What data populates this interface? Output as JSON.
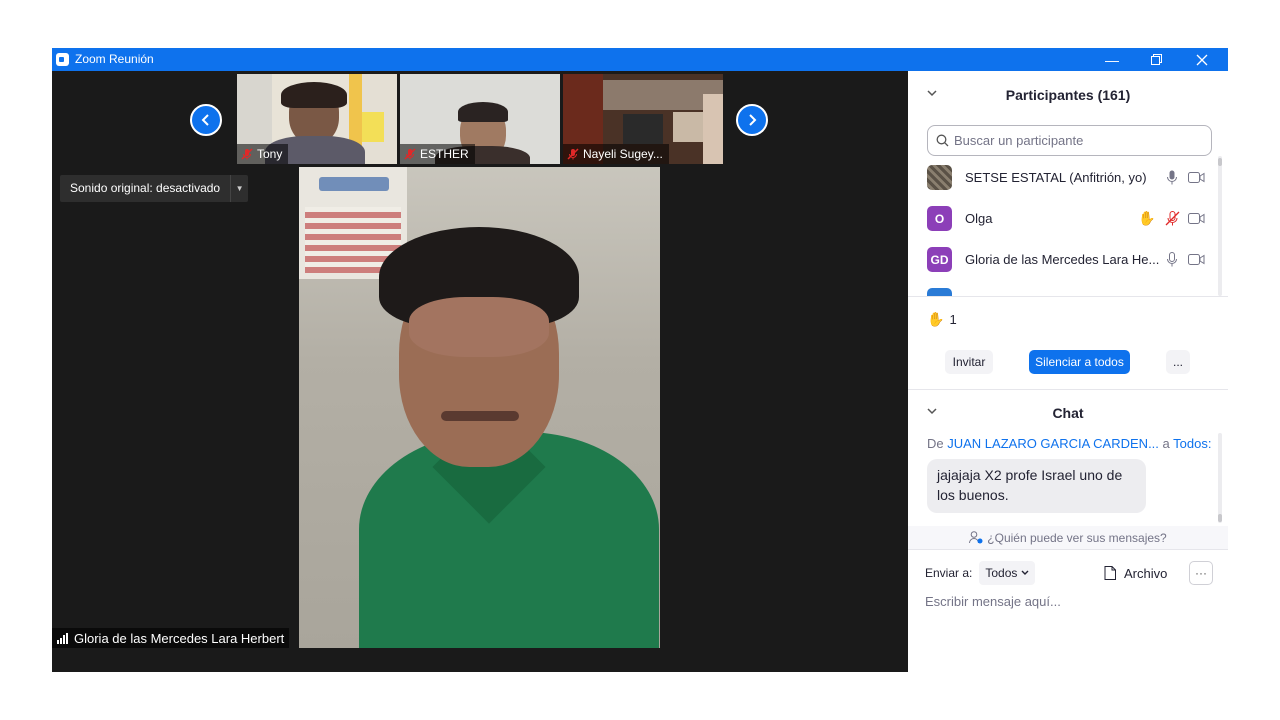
{
  "window": {
    "title": "Zoom Reunión"
  },
  "thumbnails": [
    {
      "name": "Tony"
    },
    {
      "name": "ESTHER"
    },
    {
      "name": "Nayeli Sugey..."
    }
  ],
  "sound_button": {
    "label": "Sonido original: desactivado"
  },
  "speaker": {
    "name": "Gloria de las Mercedes Lara Herbert"
  },
  "participants": {
    "header": "Participantes (161)",
    "search_placeholder": "Buscar un participante",
    "items": [
      {
        "name": "SETSE ESTATAL (Anfitrión, yo)",
        "initials": "",
        "avatar_color": "#6b6256",
        "hand": false,
        "mic_muted": false
      },
      {
        "name": "Olga",
        "initials": "O",
        "avatar_color": "#8c3fb8",
        "hand": true,
        "mic_muted": true
      },
      {
        "name": "Gloria de las Mercedes Lara He...",
        "initials": "GD",
        "avatar_color": "#8c3fb8",
        "hand": false,
        "mic_muted": false
      }
    ],
    "raised_hands": "1",
    "invite_label": "Invitar",
    "mute_all_label": "Silenciar a todos",
    "more_label": "..."
  },
  "chat": {
    "header": "Chat",
    "from_prefix": "De",
    "sender": "JUAN LAZARO GARCIA CARDEN...",
    "to_prefix": "a",
    "recipient": "Todos:",
    "message": "jajajaja X2 profe Israel uno de los buenos.",
    "who_can_see": "¿Quién puede ver sus mensajes?",
    "send_to_label": "Enviar a:",
    "send_to_value": "Todos",
    "file_label": "Archivo",
    "more_label": "···",
    "input_placeholder": "Escribir mensaje aquí..."
  },
  "colors": {
    "accent": "#0e72ed",
    "danger": "#e02828",
    "hand": "#f0b429"
  }
}
